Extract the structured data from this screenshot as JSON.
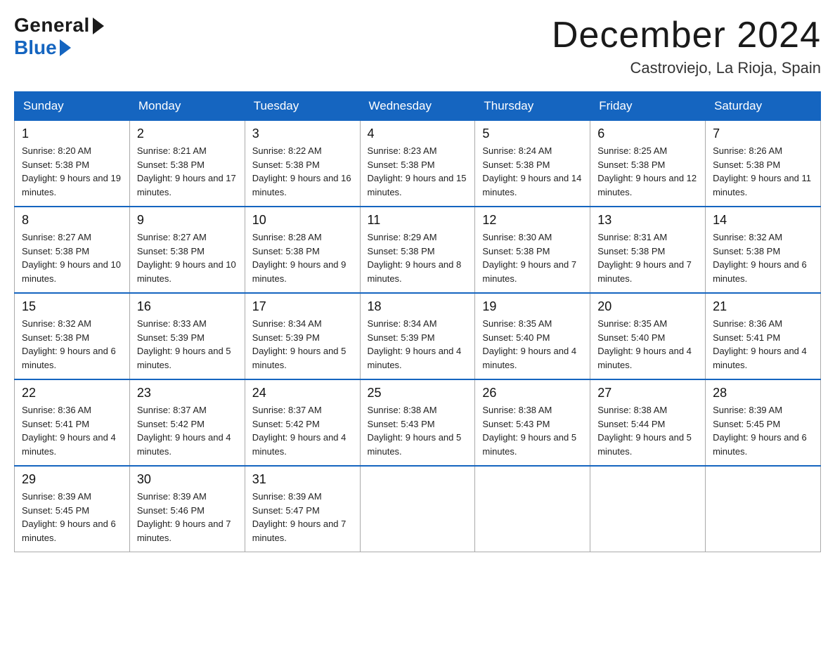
{
  "logo": {
    "general": "General",
    "blue": "Blue"
  },
  "title": {
    "month_year": "December 2024",
    "location": "Castroviejo, La Rioja, Spain"
  },
  "headers": [
    "Sunday",
    "Monday",
    "Tuesday",
    "Wednesday",
    "Thursday",
    "Friday",
    "Saturday"
  ],
  "weeks": [
    [
      {
        "day": "1",
        "sunrise": "8:20 AM",
        "sunset": "5:38 PM",
        "daylight": "9 hours and 19 minutes."
      },
      {
        "day": "2",
        "sunrise": "8:21 AM",
        "sunset": "5:38 PM",
        "daylight": "9 hours and 17 minutes."
      },
      {
        "day": "3",
        "sunrise": "8:22 AM",
        "sunset": "5:38 PM",
        "daylight": "9 hours and 16 minutes."
      },
      {
        "day": "4",
        "sunrise": "8:23 AM",
        "sunset": "5:38 PM",
        "daylight": "9 hours and 15 minutes."
      },
      {
        "day": "5",
        "sunrise": "8:24 AM",
        "sunset": "5:38 PM",
        "daylight": "9 hours and 14 minutes."
      },
      {
        "day": "6",
        "sunrise": "8:25 AM",
        "sunset": "5:38 PM",
        "daylight": "9 hours and 12 minutes."
      },
      {
        "day": "7",
        "sunrise": "8:26 AM",
        "sunset": "5:38 PM",
        "daylight": "9 hours and 11 minutes."
      }
    ],
    [
      {
        "day": "8",
        "sunrise": "8:27 AM",
        "sunset": "5:38 PM",
        "daylight": "9 hours and 10 minutes."
      },
      {
        "day": "9",
        "sunrise": "8:27 AM",
        "sunset": "5:38 PM",
        "daylight": "9 hours and 10 minutes."
      },
      {
        "day": "10",
        "sunrise": "8:28 AM",
        "sunset": "5:38 PM",
        "daylight": "9 hours and 9 minutes."
      },
      {
        "day": "11",
        "sunrise": "8:29 AM",
        "sunset": "5:38 PM",
        "daylight": "9 hours and 8 minutes."
      },
      {
        "day": "12",
        "sunrise": "8:30 AM",
        "sunset": "5:38 PM",
        "daylight": "9 hours and 7 minutes."
      },
      {
        "day": "13",
        "sunrise": "8:31 AM",
        "sunset": "5:38 PM",
        "daylight": "9 hours and 7 minutes."
      },
      {
        "day": "14",
        "sunrise": "8:32 AM",
        "sunset": "5:38 PM",
        "daylight": "9 hours and 6 minutes."
      }
    ],
    [
      {
        "day": "15",
        "sunrise": "8:32 AM",
        "sunset": "5:38 PM",
        "daylight": "9 hours and 6 minutes."
      },
      {
        "day": "16",
        "sunrise": "8:33 AM",
        "sunset": "5:39 PM",
        "daylight": "9 hours and 5 minutes."
      },
      {
        "day": "17",
        "sunrise": "8:34 AM",
        "sunset": "5:39 PM",
        "daylight": "9 hours and 5 minutes."
      },
      {
        "day": "18",
        "sunrise": "8:34 AM",
        "sunset": "5:39 PM",
        "daylight": "9 hours and 4 minutes."
      },
      {
        "day": "19",
        "sunrise": "8:35 AM",
        "sunset": "5:40 PM",
        "daylight": "9 hours and 4 minutes."
      },
      {
        "day": "20",
        "sunrise": "8:35 AM",
        "sunset": "5:40 PM",
        "daylight": "9 hours and 4 minutes."
      },
      {
        "day": "21",
        "sunrise": "8:36 AM",
        "sunset": "5:41 PM",
        "daylight": "9 hours and 4 minutes."
      }
    ],
    [
      {
        "day": "22",
        "sunrise": "8:36 AM",
        "sunset": "5:41 PM",
        "daylight": "9 hours and 4 minutes."
      },
      {
        "day": "23",
        "sunrise": "8:37 AM",
        "sunset": "5:42 PM",
        "daylight": "9 hours and 4 minutes."
      },
      {
        "day": "24",
        "sunrise": "8:37 AM",
        "sunset": "5:42 PM",
        "daylight": "9 hours and 4 minutes."
      },
      {
        "day": "25",
        "sunrise": "8:38 AM",
        "sunset": "5:43 PM",
        "daylight": "9 hours and 5 minutes."
      },
      {
        "day": "26",
        "sunrise": "8:38 AM",
        "sunset": "5:43 PM",
        "daylight": "9 hours and 5 minutes."
      },
      {
        "day": "27",
        "sunrise": "8:38 AM",
        "sunset": "5:44 PM",
        "daylight": "9 hours and 5 minutes."
      },
      {
        "day": "28",
        "sunrise": "8:39 AM",
        "sunset": "5:45 PM",
        "daylight": "9 hours and 6 minutes."
      }
    ],
    [
      {
        "day": "29",
        "sunrise": "8:39 AM",
        "sunset": "5:45 PM",
        "daylight": "9 hours and 6 minutes."
      },
      {
        "day": "30",
        "sunrise": "8:39 AM",
        "sunset": "5:46 PM",
        "daylight": "9 hours and 7 minutes."
      },
      {
        "day": "31",
        "sunrise": "8:39 AM",
        "sunset": "5:47 PM",
        "daylight": "9 hours and 7 minutes."
      },
      null,
      null,
      null,
      null
    ]
  ]
}
